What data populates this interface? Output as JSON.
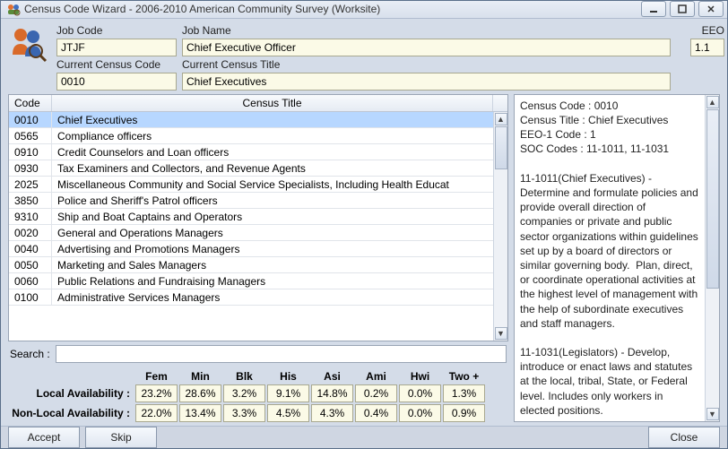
{
  "window": {
    "title": "Census Code Wizard - 2006-2010 American Community Survey (Worksite)"
  },
  "form": {
    "job_code_label": "Job Code",
    "job_code": "JTJF",
    "job_name_label": "Job Name",
    "job_name": "Chief Executive Officer",
    "eeo_label": "EEO",
    "eeo": "1.1",
    "current_census_code_label": "Current Census Code",
    "current_census_code": "0010",
    "current_census_title_label": "Current Census Title",
    "current_census_title": "Chief Executives"
  },
  "table": {
    "col_code": "Code",
    "col_title": "Census Title",
    "rows": [
      {
        "code": "0010",
        "title": "Chief Executives",
        "selected": true
      },
      {
        "code": "0565",
        "title": "Compliance officers"
      },
      {
        "code": "0910",
        "title": "Credit Counselors and Loan officers"
      },
      {
        "code": "0930",
        "title": "Tax Examiners and Collectors, and Revenue Agents"
      },
      {
        "code": "2025",
        "title": "Miscellaneous Community and Social Service Specialists, Including Health Educat"
      },
      {
        "code": "3850",
        "title": "Police and Sheriff's Patrol officers"
      },
      {
        "code": "9310",
        "title": "Ship and Boat Captains and Operators"
      },
      {
        "code": "0020",
        "title": "General and Operations Managers"
      },
      {
        "code": "0040",
        "title": "Advertising and Promotions Managers"
      },
      {
        "code": "0050",
        "title": "Marketing and Sales Managers"
      },
      {
        "code": "0060",
        "title": "Public Relations and Fundraising Managers"
      },
      {
        "code": "0100",
        "title": "Administrative Services Managers"
      }
    ]
  },
  "search": {
    "label": "Search :",
    "value": ""
  },
  "availability": {
    "columns": [
      "Fem",
      "Min",
      "Blk",
      "His",
      "Asi",
      "Ami",
      "Hwi",
      "Two +"
    ],
    "rows": [
      {
        "label": "Local Availability :",
        "values": [
          "23.2%",
          "28.6%",
          "3.2%",
          "9.1%",
          "14.8%",
          "0.2%",
          "0.0%",
          "1.3%"
        ]
      },
      {
        "label": "Non-Local Availability :",
        "values": [
          "22.0%",
          "13.4%",
          "3.3%",
          "4.5%",
          "4.3%",
          "0.4%",
          "0.0%",
          "0.9%"
        ]
      }
    ]
  },
  "description": "Census Code : 0010\nCensus Title : Chief Executives\nEEO-1 Code : 1\nSOC Codes : 11-1011, 11-1031\n\n11-1011(Chief Executives) - Determine and formulate policies and provide overall direction of companies or private and public sector organizations within guidelines set up by a board of directors or similar governing body.  Plan, direct, or coordinate operational activities at the highest level of management with the help of subordinate executives and staff managers.\n\n11-1031(Legislators) - Develop, introduce or enact laws and statutes at the local, tribal, State, or Federal level. Includes only workers in elected positions.",
  "buttons": {
    "accept": "Accept",
    "skip": "Skip",
    "close": "Close"
  }
}
